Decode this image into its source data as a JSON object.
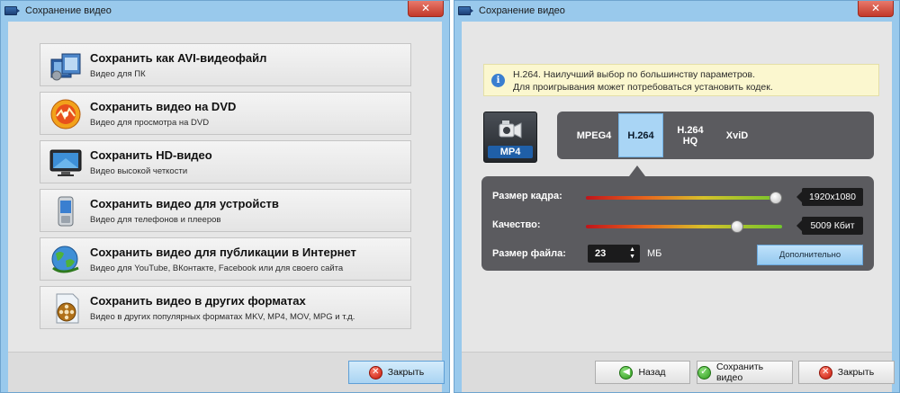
{
  "left_window": {
    "title": "Сохранение видео",
    "options": [
      {
        "title": "Сохранить как AVI-видеофайл",
        "subtitle": "Видео для ПК",
        "icon": "avi-film-icon"
      },
      {
        "title": "Сохранить видео на DVD",
        "subtitle": "Видео для просмотра на DVD",
        "icon": "dvd-disc-icon"
      },
      {
        "title": "Сохранить HD-видео",
        "subtitle": "Видео высокой четкости",
        "icon": "hd-monitor-icon"
      },
      {
        "title": "Сохранить видео для устройств",
        "subtitle": "Видео для телефонов и плееров",
        "icon": "phone-device-icon"
      },
      {
        "title": "Сохранить видео для публикации в Интернет",
        "subtitle": "Видео для YouTube, ВКонтакте, Facebook или для своего сайта",
        "icon": "globe-internet-icon"
      },
      {
        "title": "Сохранить видео в других форматах",
        "subtitle": "Видео в других популярных форматах MKV, MP4, MOV, MPG и т.д.",
        "icon": "film-reel-document-icon"
      }
    ],
    "close_button": "Закрыть"
  },
  "right_window": {
    "title": "Сохранение видео",
    "info": {
      "line1": "H.264. Наилучший выбор по большинству параметров.",
      "line2": "Для проигрывания может потребоваться установить кодек."
    },
    "format_badge": "MP4",
    "codecs": [
      {
        "label": "MPEG4",
        "active": false
      },
      {
        "label": "H.264",
        "active": true
      },
      {
        "label": "H.264\nHQ",
        "active": false
      },
      {
        "label": "XviD",
        "active": false
      }
    ],
    "frame_size": {
      "label": "Размер кадра:",
      "value": "1920x1080",
      "level": 1.0
    },
    "quality": {
      "label": "Качество:",
      "value": "5009 Кбит",
      "level": 0.79
    },
    "file_size": {
      "label": "Размер файла:",
      "value": "23",
      "unit": "МБ"
    },
    "advanced_button": "Дополнительно",
    "buttons": {
      "back": "Назад",
      "save": "Сохранить видео",
      "close": "Закрыть"
    }
  },
  "colors": {
    "titlebar": "#99c9ec",
    "panel_dark": "#5b5b5f",
    "accent_blue": "#a9d5f5",
    "info_bg": "#fbf7cf"
  }
}
